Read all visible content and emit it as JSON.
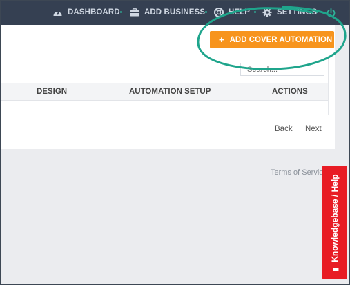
{
  "topnav": {
    "items": [
      {
        "label": "DASHBOARD",
        "icon": "dashboard-icon"
      },
      {
        "label": "ADD BUSINESS",
        "icon": "briefcase-icon"
      },
      {
        "label": "HELP",
        "icon": "lifebuoy-icon"
      },
      {
        "label": "SETTINGS",
        "icon": "gear-icon"
      }
    ],
    "power_icon": "power-icon",
    "separator_color": "#2fb39a"
  },
  "toolbar": {
    "add_button_label": "ADD COVER AUTOMATION",
    "add_button_icon": "plus-icon",
    "add_button_color": "#f7941d"
  },
  "table": {
    "search_placeholder": "Search...",
    "columns": [
      "DESIGN",
      "AUTOMATION SETUP",
      "ACTIONS"
    ]
  },
  "pagination": {
    "back": "Back",
    "next": "Next"
  },
  "footer": {
    "terms": "Terms of Servic"
  },
  "help_tab": {
    "label": "Knowledgebase / Help",
    "icon": "book-icon",
    "color": "#e81c24"
  },
  "annotation": {
    "color": "#1fa58c"
  }
}
